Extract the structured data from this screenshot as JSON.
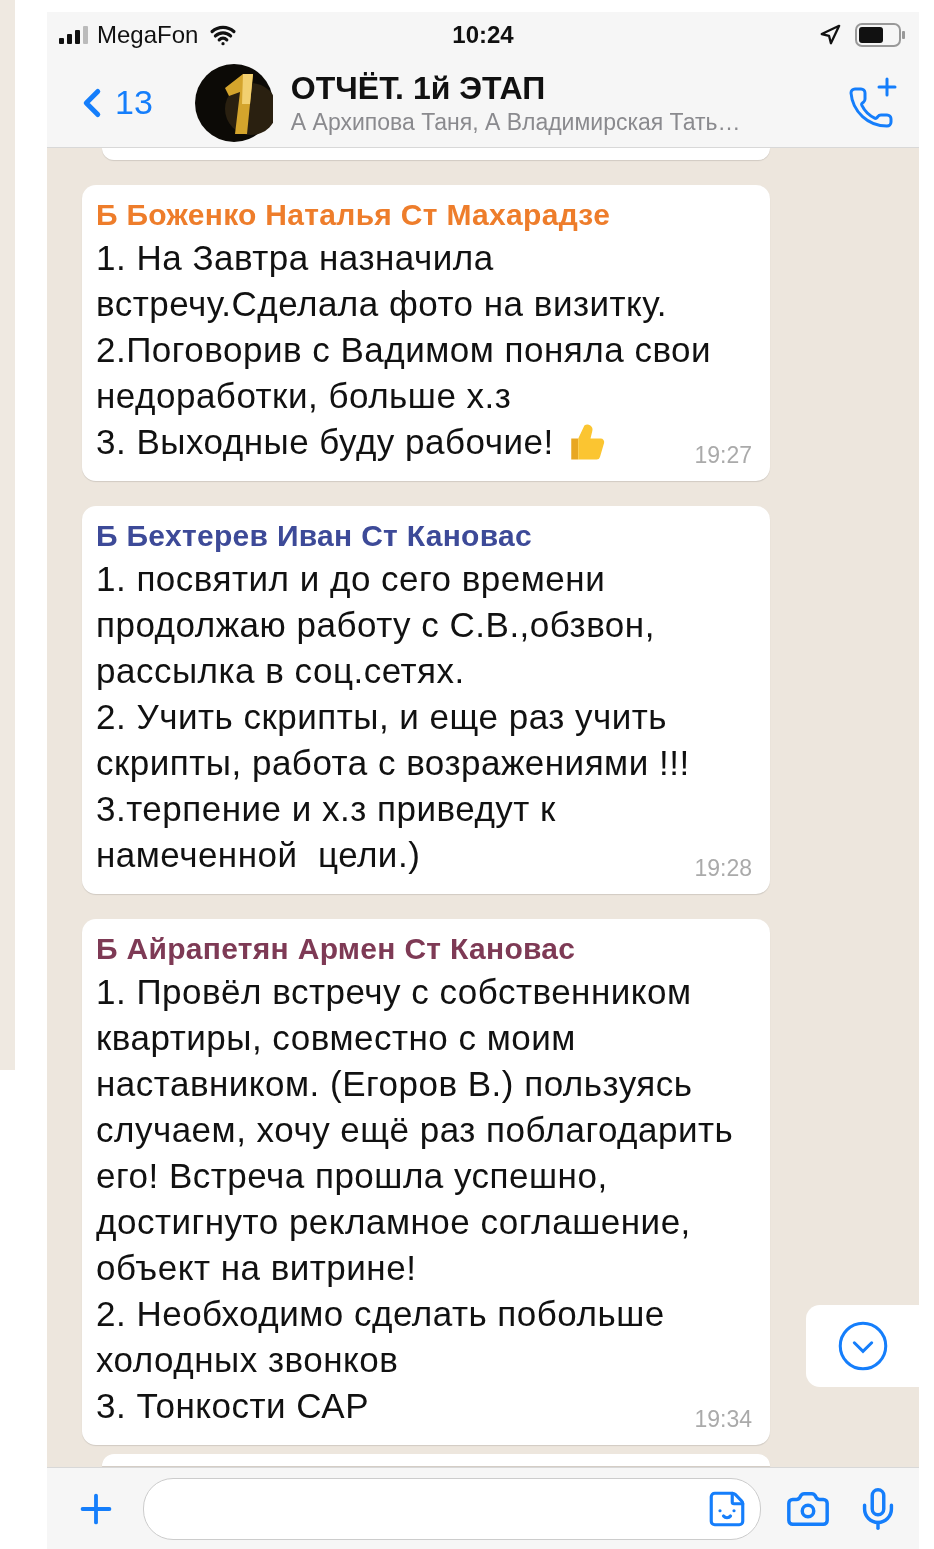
{
  "status_bar": {
    "carrier": "MegaFon",
    "time": "10:24"
  },
  "header": {
    "back_count": "13",
    "title": "ОТЧЁТ. 1й ЭТАП",
    "subtitle": "А Архипова Таня, А Владимирская Тать…"
  },
  "messages": [
    {
      "sender": "Б Боженко Наталья Ст Махарадзе",
      "color": "#ee7d2b",
      "paragraphs": [
        "1. На Завтра назначила встречу.Сделала фото на визитку.",
        "2.Поговорив с Вадимом поняла свои недоработки, больше х.з",
        "3. Выходные буду рабочие!"
      ],
      "thumbs_up_emoji": true,
      "time": "19:27"
    },
    {
      "sender": "Б Бехтерев Иван Ст Кановас",
      "color": "#3d4a98",
      "paragraphs": [
        "1. посвятил и до сего времени продолжаю работу с С.В.,обзвон, рассылка в соц.сетях.",
        "2. Учить скрипты, и еще раз учить скрипты, работа с возражениями !!!",
        "3.терпение и х.з приведут к намеченной  цели.)"
      ],
      "time": "19:28"
    },
    {
      "sender": "Б Айрапетян Армен Ст Кановас",
      "color": "#7e3a55",
      "paragraphs": [
        "1. Провёл встречу с собственником квартиры, совместно с моим наставником. (Егоров В.) пользуясь случаем, хочу ещё раз поблагодарить его! Встреча прошла успешно, достигнуто рекламное соглашение, объект на витрине!",
        "2. Необходимо сделать побольше холодных звонков",
        "3. Тонкости САР"
      ],
      "time": "19:34"
    }
  ]
}
